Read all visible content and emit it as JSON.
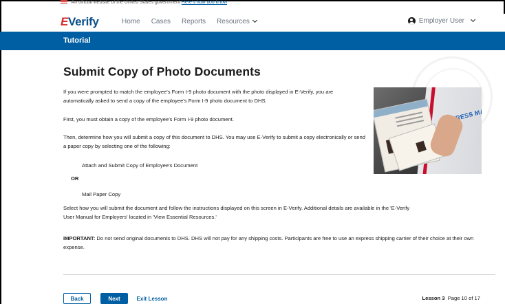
{
  "gov_banner": {
    "text": "An official website of the United States government",
    "link": "Here's how you know"
  },
  "header": {
    "logo": "E-Verify",
    "nav": [
      {
        "label": "Home"
      },
      {
        "label": "Cases"
      },
      {
        "label": "Reports"
      },
      {
        "label": "Resources"
      }
    ],
    "user": "Employer User"
  },
  "title_bar": {
    "label": "Tutorial"
  },
  "content": {
    "title": "Submit Copy of Photo Documents",
    "p1": "If you were prompted to match the employee's Form I-9 photo document with the photo displayed in E-Verify, you are automatically asked to send a copy of the employee's Form I-9 photo document to DHS.",
    "p2": "First, you must obtain a copy of the employee's Form I-9 photo document.",
    "p3": "Then, determine how you will submit a copy of this document to DHS. You may use E-Verify to submit a copy electronically or send a paper copy by selecting one of the following:",
    "option1": "Attach and Submit Copy of Employee's Document",
    "or": "OR",
    "option2": "Mail Paper Copy",
    "p4": "Select how you will submit the document and follow the instructions displayed on this screen in E-Verify. Additional details are available in the 'E-Verify User Manual for Employers' located in 'View Essential Resources.'",
    "important_label": "IMPORTANT:",
    "important_text": " Do not send original documents to DHS. DHS will not pay for any shipping costs. Participants are free to use an express shipping carrier of their choice at their own expense.",
    "image_text": "EXPRESS MAIL"
  },
  "footer": {
    "back": "Back",
    "next": "Next",
    "exit": "Exit Lesson",
    "lesson_label": "Lesson 3",
    "page_info": "Page 10 of 17"
  },
  "colors": {
    "primary": "#005ea2",
    "logo_red": "#d62828"
  }
}
